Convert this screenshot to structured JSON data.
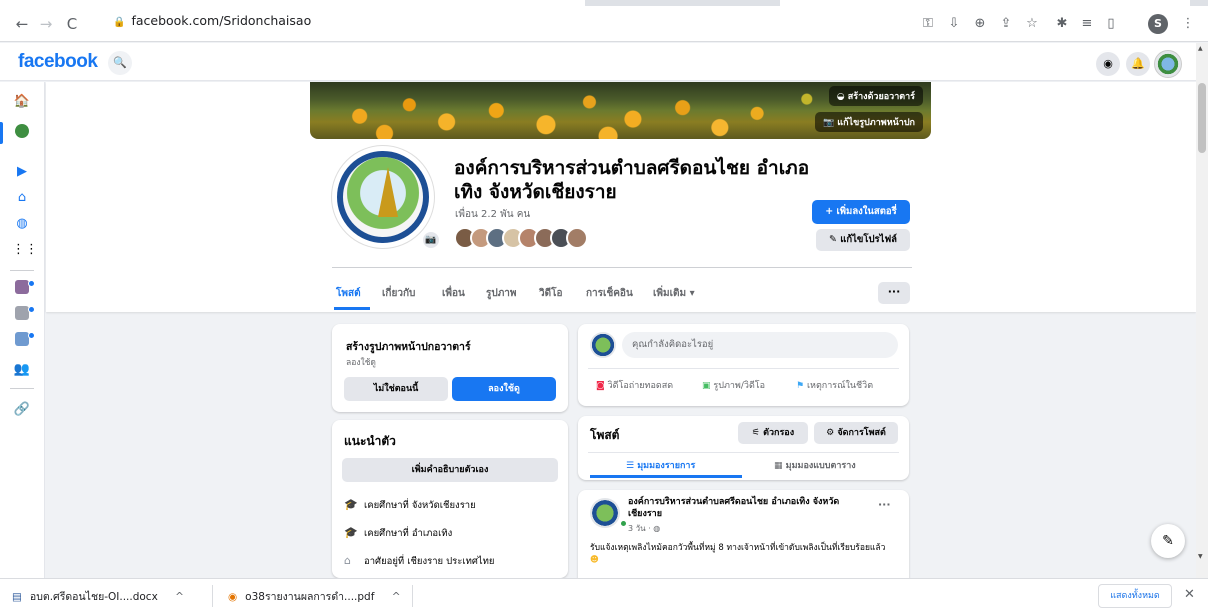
{
  "browser": {
    "url": "facebook.com/Sridonchaisao",
    "back_icon": "←",
    "forward_icon": "→",
    "reload_icon": "C"
  },
  "fb": {
    "logo": "facebook"
  },
  "cover": {
    "create_avatar_label": "สร้างด้วยอวาตาร์",
    "edit_cover_label": "แก้ไขรูปภาพหน้าปก"
  },
  "profile": {
    "name": "องค์การบริหารส่วนตำบลศรีดอนไชย อำเภอเทิง จังหวัดเชียงราย",
    "friends": "เพื่อน 2.2 พัน คน",
    "add_story_label": "+ เพิ่มลงในสตอรี่",
    "edit_profile_label": "แก้ไขโปรไฟล์"
  },
  "tabs": [
    {
      "label": "โพสต์"
    },
    {
      "label": "เกี่ยวกับ"
    },
    {
      "label": "เพื่อน"
    },
    {
      "label": "รูปภาพ"
    },
    {
      "label": "วิดีโอ"
    },
    {
      "label": "การเช็คอิน"
    },
    {
      "label": "เพิ่มเติม ▾"
    }
  ],
  "avatar_card": {
    "title": "สร้างรูปภาพหน้าปกอวาตาร์",
    "subtitle": "ลองใช้ดู",
    "not_now": "ไม่ใช่ตอนนี้",
    "try_it": "ลองใช้ดู"
  },
  "intro": {
    "title": "แนะนำตัว",
    "add_bio": "เพิ่มคำอธิบายตัวเอง",
    "rows": [
      "เคยศึกษาที่ จังหวัดเชียงราย",
      "เคยศึกษาที่ อำเภอเทิง",
      "อาศัยอยู่ที่ เชียงราย ประเทศไทย"
    ]
  },
  "composer": {
    "placeholder": "คุณกำลังคิดอะไรอยู่",
    "live": "วิดีโอถ่ายทอดสด",
    "photo": "รูปภาพ/วิดีโอ",
    "life_event": "เหตุการณ์ในชีวิต"
  },
  "posts_header": {
    "title": "โพสต์",
    "filter": "ตัวกรอง",
    "manage": "จัดการโพสต์",
    "list_view": "มุมมองรายการ",
    "grid_view": "มุมมองแบบตาราง"
  },
  "post": {
    "author": "องค์การบริหารส่วนตำบลศรีดอนไชย อำเภอเทิง จังหวัดเชียงราย",
    "time": "3 วัน · ",
    "text": "รับแจ้งเหตุเพลิงไหม้คอกวัวพื้นที่หมู่ 8 ทางเจ้าหน้าที่เข้าดับเพลิงเป็นที่เรียบร้อยแล้ว"
  },
  "downloads": [
    {
      "name": "อบต.ศรีดอนไชย-OI....docx"
    },
    {
      "name": "o38รายงานผลการดำ....pdf"
    }
  ],
  "downloads_show_all": "แสดงทั้งหมด",
  "colors": {
    "fb_blue": "#1877f2",
    "background": "#f0f2f5"
  }
}
